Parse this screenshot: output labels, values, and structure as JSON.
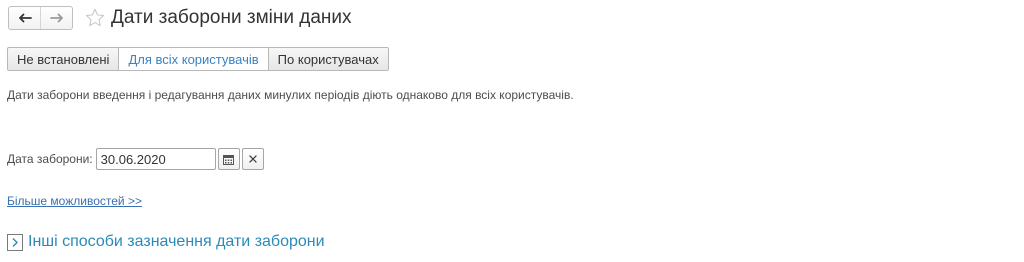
{
  "header": {
    "title": "Дати заборони зміни даних",
    "back_icon": "arrow-left-icon",
    "forward_icon": "arrow-right-icon",
    "favorite_icon": "star-icon"
  },
  "tabs": [
    {
      "label": "Не встановлені",
      "active": false
    },
    {
      "label": "Для всіх користувачів",
      "active": true
    },
    {
      "label": "По користувачах",
      "active": false
    }
  ],
  "description": "Дати заборони введення і редагування даних минулих періодів діють однаково для всіх користувачів.",
  "date_field": {
    "label": "Дата заборони:",
    "value": "30.06.2020",
    "calendar_icon": "calendar-icon",
    "clear_icon": "clear-icon"
  },
  "more_link": "Більше можливостей >>",
  "group": {
    "title": "Інші способи зазначення дати заборони",
    "expander_icon": "chevron-right-icon"
  },
  "colors": {
    "accent": "#3a82c4",
    "link": "#3a6fb0",
    "group_title": "#2a8ab8"
  }
}
